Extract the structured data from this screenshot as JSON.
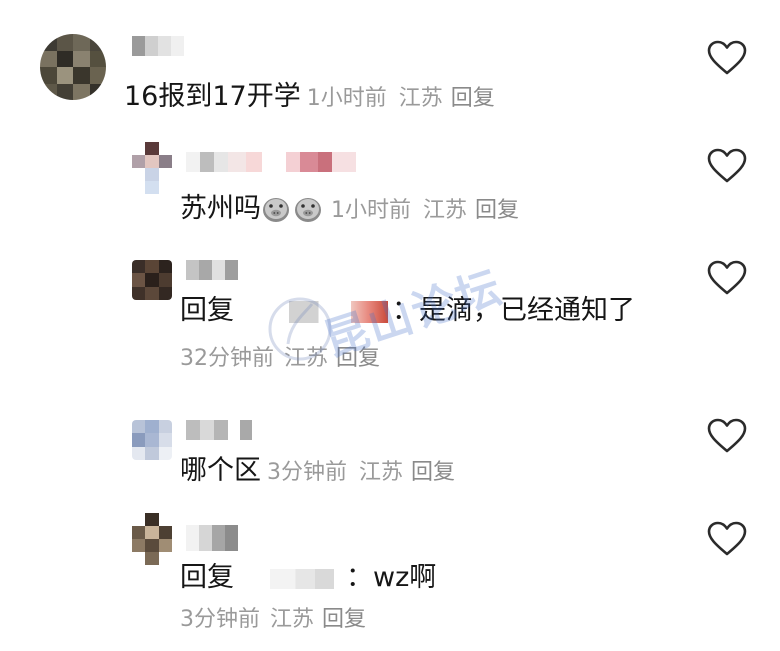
{
  "comments": [
    {
      "text": "16报到17开学",
      "time": "1小时前",
      "location": "江苏",
      "reply_label": "回复"
    },
    {
      "text": "苏州吗",
      "emoji": "pig-face-emoji",
      "time": "1小时前",
      "location": "江苏",
      "reply_label": "回复"
    },
    {
      "reply_prefix": "回复",
      "separator": "：",
      "text": "是滴，已经通知了",
      "time": "32分钟前",
      "location": "江苏",
      "reply_label": "回复"
    },
    {
      "text": "哪个区",
      "time": "3分钟前",
      "location": "江苏",
      "reply_label": "回复"
    },
    {
      "reply_prefix": "回复",
      "separator": "：",
      "text": "wz啊",
      "time": "3分钟前",
      "location": "江苏",
      "reply_label": "回复"
    }
  ],
  "watermark": "昆山论坛",
  "icons": {
    "like": "heart-outline-icon"
  },
  "colors": {
    "text": "#161616",
    "meta": "#9a9a9a",
    "heart": "#2b2b2b"
  }
}
